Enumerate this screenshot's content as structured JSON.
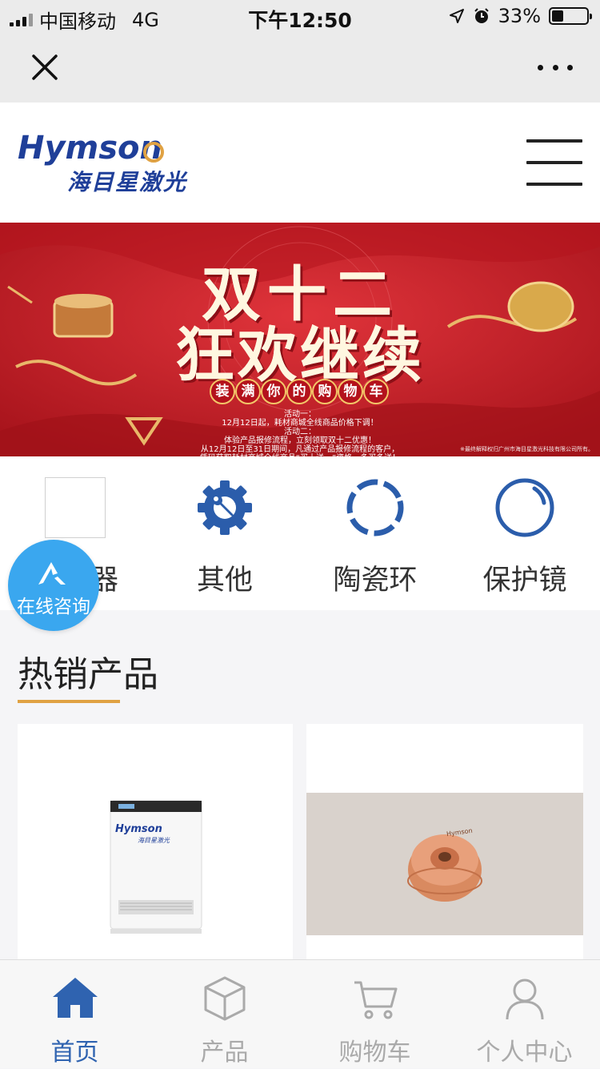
{
  "status": {
    "carrier": "中国移动",
    "network": "4G",
    "time": "下午12:50",
    "battery": "33%",
    "battery_level": 0.33
  },
  "nav": {
    "close_icon": "close-icon",
    "more_icon": "more-icon"
  },
  "header": {
    "logo_brand": "Hymson",
    "logo_sub": "海目星激光",
    "menu_icon": "hamburger-icon"
  },
  "banner": {
    "title_line1": "双十二",
    "title_line2": "狂欢继续",
    "pill_chars": [
      "装",
      "满",
      "你",
      "的",
      "购",
      "物",
      "车"
    ],
    "promo_lines": [
      "活动一：",
      "12月12日起，耗材商城全线商品价格下调！",
      "活动二：",
      "体验产品报修流程，立刻领取双十二优惠！",
      "从12月12日至31日期间，凡通过产品报修流程的客户，",
      "凭码获取耗材商城全线商品“买十送一”资格，多买多送！"
    ],
    "copyright": "※最终解释权归广州市海目星激光科技有限公司所有。"
  },
  "categories": [
    {
      "label": "器",
      "icon": "placeholder-image"
    },
    {
      "label": "其他",
      "icon": "gear-wrench-icon"
    },
    {
      "label": "陶瓷环",
      "icon": "dashed-ring-icon"
    },
    {
      "label": "保护镜",
      "icon": "lens-icon"
    }
  ],
  "float_button": {
    "label": "在线咨询",
    "icon": "consult-logo-icon"
  },
  "hot": {
    "title": "热销产品",
    "products": [
      {
        "image": "laser-cabinet-image",
        "brand_text": "Hymson",
        "brand_sub": "海目星激光"
      },
      {
        "image": "copper-nozzle-image",
        "engraving": "Hymson"
      }
    ]
  },
  "tabbar": [
    {
      "label": "首页",
      "icon": "home-icon",
      "active": true
    },
    {
      "label": "产品",
      "icon": "box-icon",
      "active": false
    },
    {
      "label": "购物车",
      "icon": "cart-icon",
      "active": false
    },
    {
      "label": "个人中心",
      "icon": "user-icon",
      "active": false
    }
  ],
  "colors": {
    "brand_blue": "#1f3f99",
    "accent_orange": "#e0a243",
    "tab_active": "#2f63b0",
    "float_blue": "#3aa7ef",
    "banner_red": "#c8202a"
  }
}
